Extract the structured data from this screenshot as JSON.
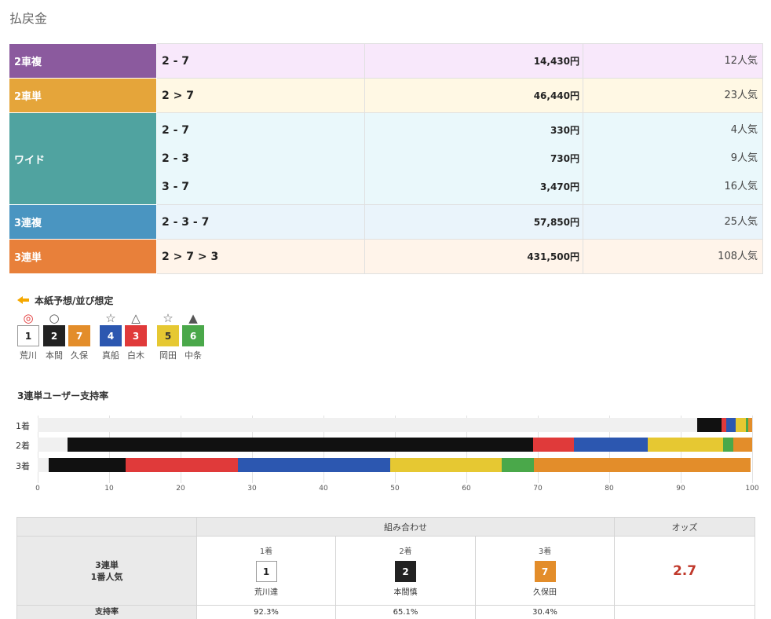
{
  "section_title": "払戻金",
  "payouts": [
    {
      "type": "2車複",
      "color": "#8b5a9e",
      "bg": "#f8e8fb",
      "entries": [
        {
          "combo": "2 - 7",
          "amount": "14,430円",
          "pop": "12人気"
        }
      ]
    },
    {
      "type": "2車単",
      "color": "#e5a53a",
      "bg": "#fff8e4",
      "entries": [
        {
          "combo": "2 > 7",
          "amount": "46,440円",
          "pop": "23人気"
        }
      ]
    },
    {
      "type": "ワイド",
      "color": "#50a3a0",
      "bg": "#eaf8fb",
      "entries": [
        {
          "combo": "2 - 7",
          "amount": "330円",
          "pop": "4人気"
        },
        {
          "combo": "2 - 3",
          "amount": "730円",
          "pop": "9人気"
        },
        {
          "combo": "3 - 7",
          "amount": "3,470円",
          "pop": "16人気"
        }
      ]
    },
    {
      "type": "3連複",
      "color": "#4a95c1",
      "bg": "#eaf4fb",
      "entries": [
        {
          "combo": "2 - 3 - 7",
          "amount": "57,850円",
          "pop": "25人気"
        }
      ]
    },
    {
      "type": "3連単",
      "color": "#e8803a",
      "bg": "#fff4ea",
      "entries": [
        {
          "combo": "2 > 7 > 3",
          "amount": "431,500円",
          "pop": "108人気"
        }
      ]
    }
  ],
  "prediction": {
    "title": "本紙予想/並び想定",
    "racers": [
      {
        "mark": "◎",
        "mark_color": "#e03030",
        "num": "1",
        "box_bg": "#ffffff",
        "box_fg": "#222222",
        "name": "荒川"
      },
      {
        "mark": "○",
        "mark_color": "#555555",
        "num": "2",
        "box_bg": "#222222",
        "box_fg": "#ffffff",
        "name": "本間"
      },
      {
        "mark": "",
        "mark_color": "#555555",
        "num": "7",
        "box_bg": "#e38d2a",
        "box_fg": "#ffffff",
        "name": "久保"
      },
      {
        "mark": "☆",
        "mark_color": "#555555",
        "num": "4",
        "box_bg": "#2c57b0",
        "box_fg": "#ffffff",
        "name": "真船"
      },
      {
        "mark": "△",
        "mark_color": "#555555",
        "num": "3",
        "box_bg": "#e03a3a",
        "box_fg": "#ffffff",
        "name": "白木"
      },
      {
        "mark": "☆",
        "mark_color": "#555555",
        "num": "5",
        "box_bg": "#e6c832",
        "box_fg": "#333333",
        "name": "岡田"
      },
      {
        "mark": "▲",
        "mark_color": "#555555",
        "num": "6",
        "box_bg": "#4aa84a",
        "box_fg": "#ffffff",
        "name": "中条"
      }
    ]
  },
  "chart_data": {
    "type": "bar",
    "title": "3連単ユーザー支持率",
    "orientation": "horizontal-stacked",
    "categories": [
      "1着",
      "2着",
      "3着"
    ],
    "xlim": [
      0,
      100
    ],
    "ticks": [
      "0",
      "10",
      "20",
      "30",
      "40",
      "50",
      "60",
      "70",
      "80",
      "90",
      "100"
    ],
    "grid": true,
    "series": [
      {
        "color": "#f0f0f0",
        "values": [
          92.3,
          4.2,
          1.5
        ]
      },
      {
        "color": "#111111",
        "values": [
          3.4,
          65.1,
          10.8
        ]
      },
      {
        "color": "#e03a3a",
        "values": [
          0.7,
          5.8,
          15.7
        ]
      },
      {
        "color": "#2c57b0",
        "values": [
          1.3,
          10.3,
          21.3
        ]
      },
      {
        "color": "#e6c832",
        "values": [
          1.4,
          10.5,
          15.6
        ]
      },
      {
        "color": "#4aa84a",
        "values": [
          0.3,
          1.5,
          4.5
        ]
      },
      {
        "color": "#e38d2a",
        "values": [
          0.6,
          2.6,
          30.4
        ]
      }
    ]
  },
  "odds_table": {
    "header_combo": "組み合わせ",
    "header_odds": "オッズ",
    "label_line1": "3連単",
    "label_line2": "1番人気",
    "positions": [
      {
        "pos": "1着",
        "num": "1",
        "box_bg": "#ffffff",
        "box_fg": "#222222",
        "name": "荒川達",
        "support": "92.3%"
      },
      {
        "pos": "2着",
        "num": "2",
        "box_bg": "#222222",
        "box_fg": "#ffffff",
        "name": "本間慎",
        "support": "65.1%"
      },
      {
        "pos": "3着",
        "num": "7",
        "box_bg": "#e38d2a",
        "box_fg": "#ffffff",
        "name": "久保田",
        "support": "30.4%"
      }
    ],
    "odds": "2.7",
    "support_label": "支持率"
  }
}
